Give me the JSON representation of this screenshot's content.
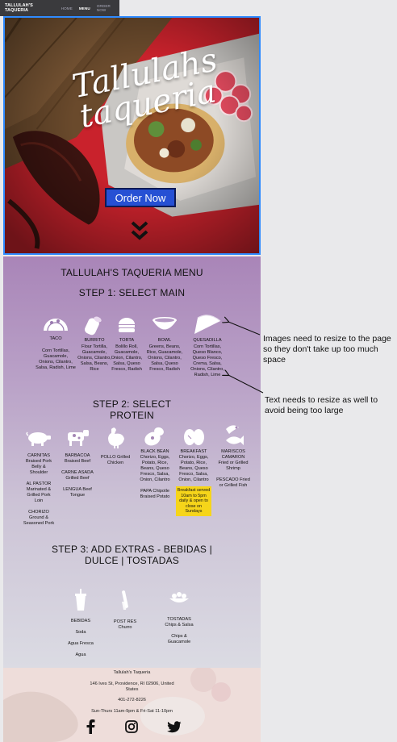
{
  "nav": {
    "brand": "TALLULAH'S TAQUERIA",
    "links": [
      "HOME",
      "MENU",
      "ORDER NOW"
    ]
  },
  "hero": {
    "title_line1": "Tallulahs",
    "title_line2": "taqueria",
    "order_button": "Order Now",
    "colors": {
      "accent": "#2650d4",
      "border": "#2f8bff",
      "background": "#c7212a"
    }
  },
  "menu": {
    "title": "TALLULAH'S TAQUERIA MENU",
    "step1": {
      "title": "STEP 1: SELECT MAIN",
      "items": [
        {
          "icon": "taco-icon",
          "name": "TACO",
          "desc": "Corn Tortillas, Guacamole, Onions, Cilantro, Salsa, Radish, Lime"
        },
        {
          "icon": "burrito-icon",
          "name": "BURRITO",
          "desc": "Flour Tortilla, Guacamole, Onions, Cilantro, Salsa, Beans, Rice"
        },
        {
          "icon": "torta-icon",
          "name": "TORTA",
          "desc": "Bolillo Roll, Guacamole, Onion, Cilantro, Salsa, Queso Fresco, Radish"
        },
        {
          "icon": "bowl-icon",
          "name": "BOWL",
          "desc": "Greens, Beans, Rice, Guacamole, Onions, Cilantro, Salsa, Queso Fresco, Radish"
        },
        {
          "icon": "quesadilla-icon",
          "name": "QUESADILLA",
          "desc": "Corn Tortillas, Queso Blanco, Queso Fresco, Crema, Salsa, Onions, Cilantro, Radish, Lime"
        }
      ]
    },
    "step2": {
      "title_line1": "STEP 2: SELECT",
      "title_line2": "PROTEIN",
      "items": [
        {
          "icon": "pig-icon",
          "entries": [
            "CARNITAS Braised Pork Belly & Shoulder",
            "AL PASTOR Marinated & Grilled Pork Loin",
            "CHORIZO Ground & Seasoned Pork"
          ]
        },
        {
          "icon": "cow-icon",
          "entries": [
            "BARBACOA Braised Beef",
            "CARNE ASADA Grilled Beef",
            "LENGUA Beef Tongue"
          ]
        },
        {
          "icon": "chicken-icon",
          "entries": [
            "POLLO Grilled Chicken"
          ]
        },
        {
          "icon": "beans-icon",
          "entries": [
            "BLACK BEAN Chorizo, Eggs, Potato, Rice, Beans, Queso Fresco, Salsa, Onion, Cilantro",
            "PAPA Chipotle Braised Potato"
          ]
        },
        {
          "icon": "eggs-icon",
          "entries": [
            "BREAKFAST Chorizo, Eggs, Potato, Rice, Beans, Queso Fresco, Salsa, Onion, Cilantro"
          ],
          "note": "Breakfast served 10am to 5pm daily & open to close on Sundays"
        },
        {
          "icon": "seafood-icon",
          "entries": [
            "MARISCOS CAMARON Fried or Grilled Shrimp",
            "PESCADO Fried or Grilled Fish"
          ]
        }
      ]
    },
    "step3": {
      "title_line1": "STEP 3: ADD EXTRAS - BEBIDAS |",
      "title_line2": "DULCE | TOSTADAS",
      "items": [
        {
          "icon": "drink-icon",
          "name": "BEBIDAS",
          "entries": [
            "Soda",
            "Agua Fresca",
            "Agua"
          ]
        },
        {
          "icon": "churro-icon",
          "name": "POST RES Churro",
          "entries": []
        },
        {
          "icon": "tostada-icon",
          "name": "TOSTADAS Chips & Salsa",
          "entries": [
            "Chips & Guacamole"
          ]
        }
      ]
    }
  },
  "annotations": [
    "Images need to resize to the page so they don't take up too much space",
    "Text needs to resize as well to avoid being too large"
  ],
  "footer": {
    "name": "Tallulah's Taqueria",
    "address": "146 Ives St, Providence, RI 02906, United States",
    "phone": "401-272-8226",
    "hours": "Sun-Thurs 11am-9pm & Fri-Sat 11-10pm",
    "social": [
      "facebook-icon",
      "instagram-icon",
      "twitter-icon"
    ]
  }
}
